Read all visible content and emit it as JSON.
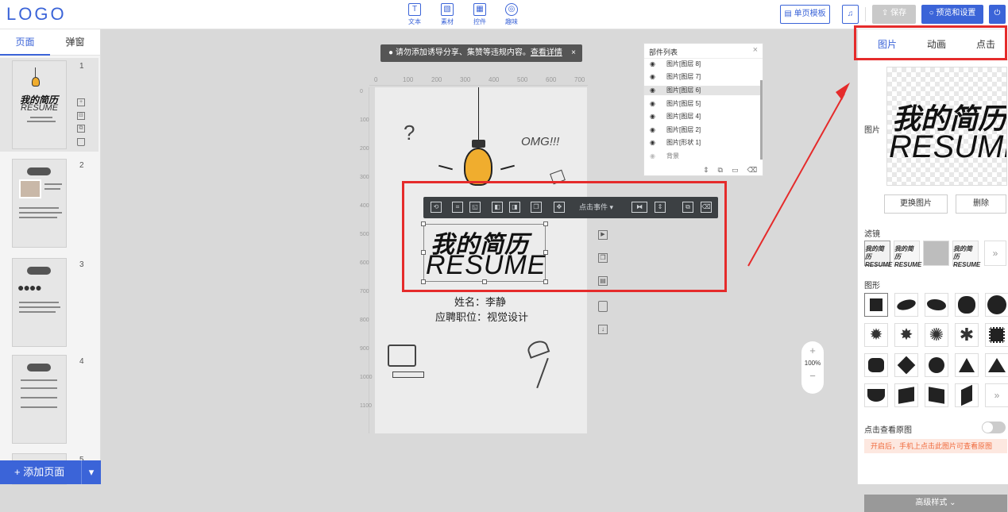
{
  "app": {
    "logo": "LOGO",
    "tools": [
      {
        "label": "文本",
        "icon": "text-icon",
        "glyph": "T"
      },
      {
        "label": "素材",
        "icon": "image-icon",
        "glyph": "▧"
      },
      {
        "label": "控件",
        "icon": "widget-icon",
        "glyph": "▦"
      },
      {
        "label": "趣味",
        "icon": "lightbulb-icon",
        "glyph": "◎"
      }
    ],
    "buttons": {
      "single_template": "单页模板",
      "music": "♫",
      "save": "保存",
      "preview_settings": "预览和设置",
      "power": "⏻"
    }
  },
  "left_panel": {
    "tabs": [
      "页面",
      "弹窗"
    ],
    "pages": [
      "1",
      "2",
      "3",
      "4",
      "5"
    ],
    "page_icons": [
      "+",
      "⊟",
      "⧉",
      "🗑"
    ],
    "add_page": "+ 添加页面",
    "add_page_menu": "▾"
  },
  "editor": {
    "notice": "请勿添加诱导分享、集赞等违规内容。",
    "notice_link": "查看详情",
    "notice_close": "×",
    "ruler_top": [
      "0",
      "100",
      "200",
      "300",
      "400",
      "500",
      "600",
      "700"
    ],
    "ruler_left": [
      "0",
      "100",
      "200",
      "300",
      "400",
      "500",
      "600",
      "700",
      "800",
      "900",
      "1000",
      "1100"
    ],
    "canvas": {
      "title_cn": "我的简历",
      "title_en": "RESUME",
      "name_line": "姓名：李静",
      "job_line": "应聘职位：视觉设计",
      "omg": "OMG!!!"
    },
    "toolbar": {
      "click_event": "点击事件",
      "click_event_caret": "▾"
    },
    "zoom": {
      "plus": "+",
      "value": "100%",
      "minus": "−"
    }
  },
  "layers": {
    "title": "部件列表",
    "close": "×",
    "items": [
      "图片[图层 8]",
      "图片[图层 7]",
      "图片[图层 6]",
      "图片[图层 5]",
      "图片[图层 4]",
      "图片[图层 2]",
      "图片[形状 1]",
      "背景"
    ],
    "selected_index": 2
  },
  "right_panel": {
    "tabs": [
      "图片",
      "动画",
      "点击"
    ],
    "active_tab": "图片",
    "image_label": "图片",
    "preview_cn": "我的简历",
    "preview_en": "RESUME",
    "replace": "更换图片",
    "delete": "删除",
    "filter_label": "滤镜",
    "more": "»",
    "shape_label": "图形",
    "toggle_label": "点击查看原图",
    "toggle_on": false,
    "hint": "开启后，手机上点击此图片可查看原图",
    "advanced": "高级样式 ⌄"
  },
  "colors": {
    "accent": "#3b64d8",
    "highlight": "#e52b2b"
  }
}
